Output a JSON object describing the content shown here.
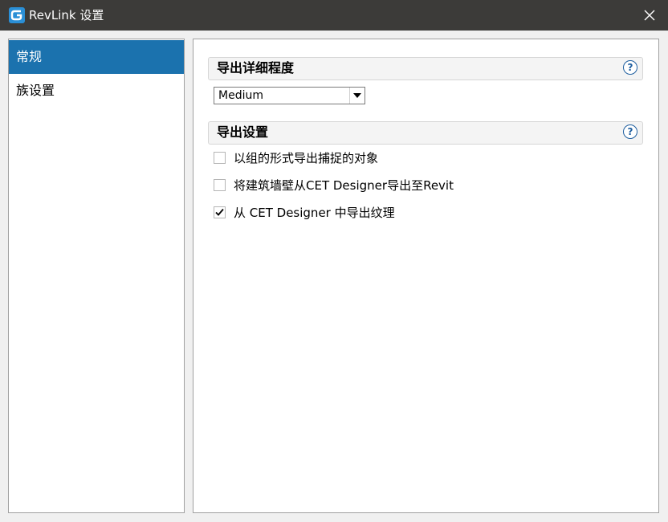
{
  "window": {
    "title": "RevLink 设置",
    "icon": "app-logo-icon",
    "close_icon": "close-icon"
  },
  "sidebar": {
    "items": [
      {
        "label": "常规",
        "active": true
      },
      {
        "label": "族设置",
        "active": false
      }
    ]
  },
  "main": {
    "detail_section": {
      "title": "导出详细程度",
      "help": "?",
      "select": {
        "value": "Medium"
      }
    },
    "export_section": {
      "title": "导出设置",
      "help": "?",
      "options": [
        {
          "label": "以组的形式导出捕捉的对象",
          "checked": false
        },
        {
          "label": "将建筑墙壁从CET Designer导出至Revit",
          "checked": false
        },
        {
          "label": "从 CET Designer 中导出纹理",
          "checked": true
        }
      ]
    }
  },
  "colors": {
    "titlebar": "#3c3b39",
    "selected": "#1b72ae",
    "help_icon": "#1f5fa0"
  }
}
